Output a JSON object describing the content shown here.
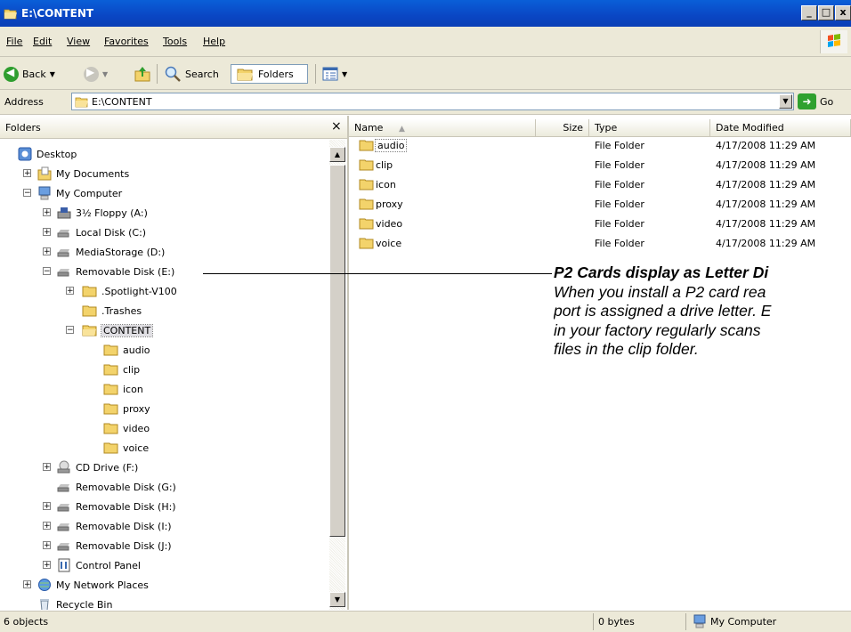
{
  "window": {
    "title": "E:\\CONTENT",
    "minimize": "_",
    "maximize": "□",
    "close": "x"
  },
  "menu": {
    "file": "File",
    "edit": "Edit",
    "view": "View",
    "favorites": "Favorites",
    "tools": "Tools",
    "help": "Help"
  },
  "toolbar": {
    "back": "Back",
    "search": "Search",
    "folders": "Folders"
  },
  "address": {
    "label": "Address",
    "value": "E:\\CONTENT",
    "go": "Go"
  },
  "folders_pane": {
    "title": "Folders",
    "close": "×",
    "items": [
      {
        "label": "Desktop",
        "icon": "desktop-icon"
      },
      {
        "label": "My Documents",
        "icon": "my-documents-icon"
      },
      {
        "label": "My Computer",
        "icon": "my-computer-icon"
      },
      {
        "label": "3½ Floppy (A:)",
        "icon": "floppy-drive-icon"
      },
      {
        "label": "Local Disk (C:)",
        "icon": "hard-drive-icon"
      },
      {
        "label": "MediaStorage (D:)",
        "icon": "hard-drive-icon"
      },
      {
        "label": "Removable Disk (E:)",
        "icon": "removable-drive-icon"
      },
      {
        "label": ".Spotlight-V100",
        "icon": "folder-icon"
      },
      {
        "label": ".Trashes",
        "icon": "folder-icon"
      },
      {
        "label": "CONTENT",
        "icon": "open-folder-icon"
      },
      {
        "label": "audio",
        "icon": "folder-icon"
      },
      {
        "label": "clip",
        "icon": "folder-icon"
      },
      {
        "label": "icon",
        "icon": "folder-icon"
      },
      {
        "label": "proxy",
        "icon": "folder-icon"
      },
      {
        "label": "video",
        "icon": "folder-icon"
      },
      {
        "label": "voice",
        "icon": "folder-icon"
      },
      {
        "label": "CD Drive (F:)",
        "icon": "cd-drive-icon"
      },
      {
        "label": "Removable Disk (G:)",
        "icon": "removable-drive-icon"
      },
      {
        "label": "Removable Disk (H:)",
        "icon": "removable-drive-icon"
      },
      {
        "label": "Removable Disk (I:)",
        "icon": "removable-drive-icon"
      },
      {
        "label": "Removable Disk (J:)",
        "icon": "removable-drive-icon"
      },
      {
        "label": "Control Panel",
        "icon": "control-panel-icon"
      },
      {
        "label": "My Network Places",
        "icon": "network-places-icon"
      },
      {
        "label": "Recycle Bin",
        "icon": "recycle-bin-icon"
      }
    ]
  },
  "files_pane": {
    "columns": {
      "name": "Name",
      "size": "Size",
      "type": "Type",
      "date": "Date Modified"
    },
    "rows": [
      {
        "name": "audio",
        "type": "File Folder",
        "date": "4/17/2008 11:29 AM"
      },
      {
        "name": "clip",
        "type": "File Folder",
        "date": "4/17/2008 11:29 AM"
      },
      {
        "name": "icon",
        "type": "File Folder",
        "date": "4/17/2008 11:29 AM"
      },
      {
        "name": "proxy",
        "type": "File Folder",
        "date": "4/17/2008 11:29 AM"
      },
      {
        "name": "video",
        "type": "File Folder",
        "date": "4/17/2008 11:29 AM"
      },
      {
        "name": "voice",
        "type": "File Folder",
        "date": "4/17/2008 11:29 AM"
      }
    ]
  },
  "callout": {
    "heading": "P2 Cards display as Letter Di",
    "line1": "When you install a P2 card rea",
    "line2": "port is assigned a drive letter. E",
    "line3": "in your factory regularly scans",
    "line4": "files in the clip folder."
  },
  "status": {
    "objects": "6 objects",
    "size": "0 bytes",
    "zone": "My Computer"
  }
}
